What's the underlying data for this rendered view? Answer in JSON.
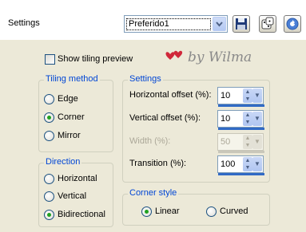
{
  "toolbar": {
    "settings_label": "Settings",
    "preset_value": "Preferido1",
    "save_icon": "floppy-disk-icon",
    "random_icon": "dice-icon",
    "reset_icon": "reset-arrow-icon"
  },
  "watermark": {
    "text": "by Wilma",
    "hearts_color": "#d0283a"
  },
  "show_tiling_preview": {
    "label": "Show tiling preview",
    "checked": false
  },
  "tiling_method": {
    "title": "Tiling method",
    "options": [
      "Edge",
      "Corner",
      "Mirror"
    ],
    "selected": "Corner"
  },
  "direction": {
    "title": "Direction",
    "options": [
      "Horizontal",
      "Vertical",
      "Bidirectional"
    ],
    "selected": "Bidirectional"
  },
  "settings_group": {
    "title": "Settings",
    "horizontal_offset": {
      "label": "Horizontal offset (%):",
      "value": "10"
    },
    "vertical_offset": {
      "label": "Vertical offset (%):",
      "value": "10"
    },
    "width": {
      "label": "Width (%):",
      "value": "50",
      "disabled": true
    },
    "transition": {
      "label": "Transition (%):",
      "value": "100"
    }
  },
  "corner_style": {
    "title": "Corner style",
    "options": [
      "Linear",
      "Curved"
    ],
    "selected": "Linear"
  },
  "colors": {
    "accent_blue": "#0046d5",
    "radio_green": "#21a121",
    "background": "#ece9d8"
  }
}
